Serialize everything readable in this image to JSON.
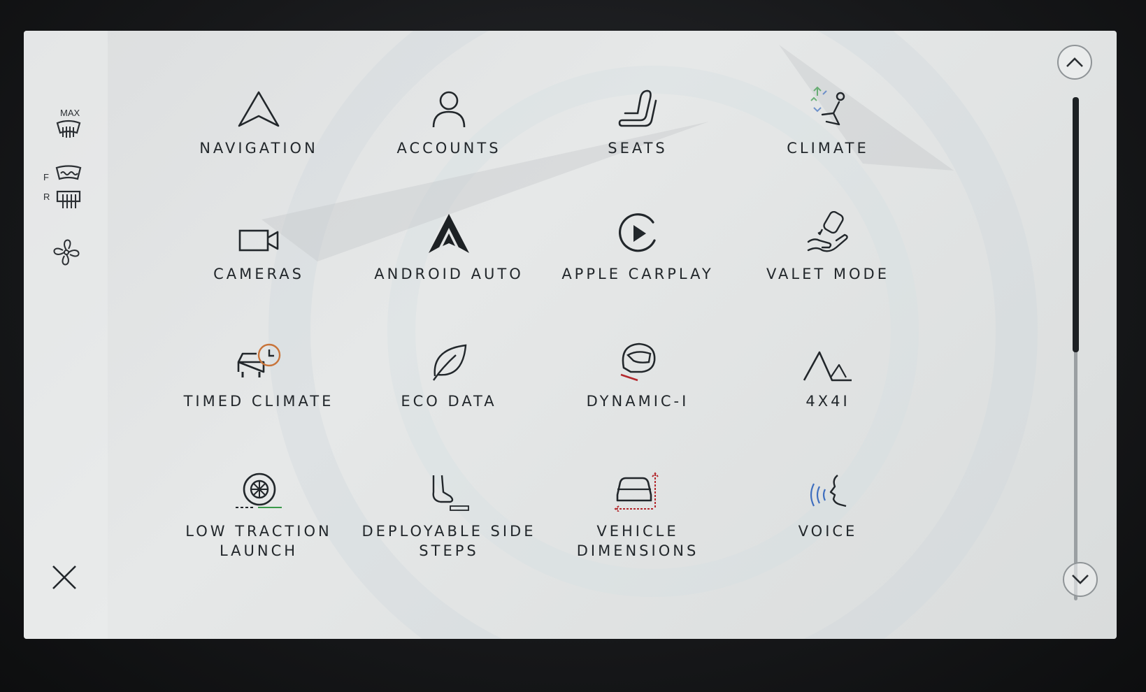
{
  "sidebar": {
    "max_defrost_label": "MAX",
    "front_label": "F",
    "rear_label": "R",
    "icons": [
      "max-defrost-icon",
      "front-defrost-icon",
      "rear-defrost-icon",
      "fan-icon"
    ]
  },
  "menu": {
    "items": [
      {
        "label": "NAVIGATION",
        "icon": "navigation-arrow-icon"
      },
      {
        "label": "ACCOUNTS",
        "icon": "account-person-icon"
      },
      {
        "label": "SEATS",
        "icon": "seat-icon"
      },
      {
        "label": "CLIMATE",
        "icon": "climate-seat-airflow-icon"
      },
      {
        "label": "CAMERAS",
        "icon": "camera-icon"
      },
      {
        "label": "ANDROID AUTO",
        "icon": "android-auto-icon"
      },
      {
        "label": "APPLE CARPLAY",
        "icon": "carplay-play-icon"
      },
      {
        "label": "VALET MODE",
        "icon": "valet-key-hand-icon"
      },
      {
        "label": "TIMED CLIMATE",
        "icon": "car-clock-icon"
      },
      {
        "label": "ECO DATA",
        "icon": "leaf-icon"
      },
      {
        "label": "DYNAMIC-I",
        "icon": "helmet-icon"
      },
      {
        "label": "4X4I",
        "icon": "mountains-icon"
      },
      {
        "label": "LOW TRACTION LAUNCH",
        "icon": "wheel-traction-icon"
      },
      {
        "label": "DEPLOYABLE SIDE STEPS",
        "icon": "foot-step-icon"
      },
      {
        "label": "VEHICLE DIMENSIONS",
        "icon": "vehicle-dimensions-icon"
      },
      {
        "label": "VOICE",
        "icon": "voice-face-icon"
      }
    ]
  },
  "scroll": {
    "position_fraction": 0.5
  },
  "colors": {
    "screen_bg": "#e0e2e2",
    "text": "#22272b",
    "accent_orange": "#c8743a",
    "accent_red": "#b3282d",
    "accent_green": "#3a9a4a",
    "accent_blue": "#3f6fbf"
  }
}
